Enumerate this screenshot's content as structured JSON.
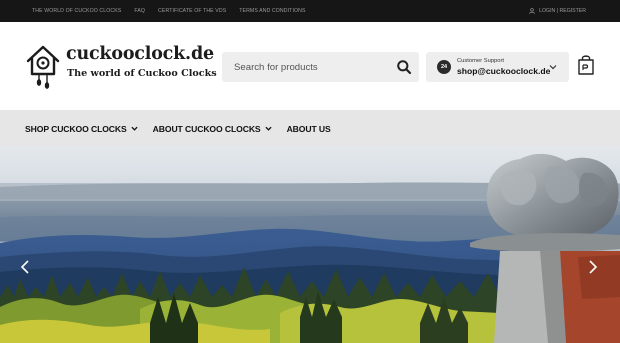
{
  "topbar": {
    "links": [
      "THE WORLD OF CUCKOO CLOCKS",
      "FAQ",
      "CERTIFICATE OF THE VDS",
      "TERMS AND CONDITIONS"
    ],
    "login_label": "LOGIN | REGISTER",
    "login_icon": "user-icon"
  },
  "header": {
    "logo_title": "cuckooclock.de",
    "logo_tagline": "The world of Cuckoo Clocks",
    "search_placeholder": "Search for products",
    "support_badge": "24",
    "support_label": "Customer Support",
    "support_email": "shop@cuckooclock.de"
  },
  "nav": {
    "items": [
      {
        "label": "SHOP CUCKOO CLOCKS",
        "has_dropdown": true
      },
      {
        "label": "ABOUT CUCKOO CLOCKS",
        "has_dropdown": true
      },
      {
        "label": "ABOUT US",
        "has_dropdown": false
      }
    ]
  },
  "colors": {
    "topbar_bg": "#161616",
    "nav_bg": "#e6e6e6",
    "field_bg": "#eeeeee",
    "text_dark": "#111111"
  },
  "icons": {
    "logo": "cuckoo-house-icon",
    "search": "search-icon",
    "support": "24h-support-icon",
    "chevron": "chevron-down-icon",
    "cart": "shopping-bag-icon",
    "slider_prev": "chevron-left-icon",
    "slider_next": "chevron-right-icon"
  }
}
